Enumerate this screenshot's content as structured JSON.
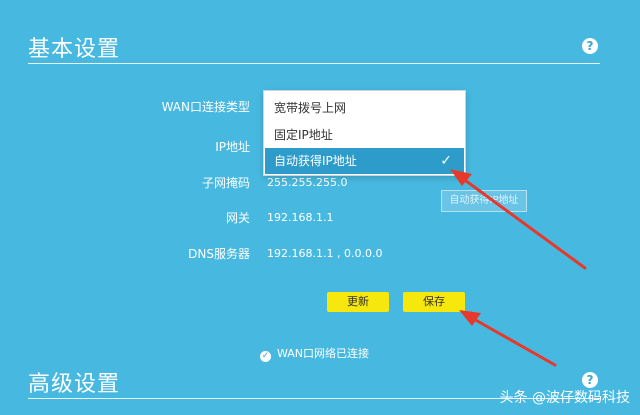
{
  "basic_settings": {
    "title": "基本设置",
    "help_icon": "question-circle-icon",
    "rows": [
      {
        "label": "WAN口连接类型",
        "value": ""
      },
      {
        "label": "IP地址",
        "value": ""
      },
      {
        "label": "子网掩码",
        "value": "255.255.255.0"
      },
      {
        "label": "网关",
        "value": "192.168.1.1"
      },
      {
        "label": "DNS服务器",
        "value": "192.168.1.1 , 0.0.0.0"
      }
    ]
  },
  "connection_type_dropdown": {
    "options": [
      "宽带拨号上网",
      "固定IP地址",
      "自动获得IP地址"
    ],
    "selected": "自动获得IP地址",
    "check_icon": "check-icon"
  },
  "tooltip": {
    "text": "自动获得IP地址"
  },
  "buttons": {
    "refresh": "更新",
    "save": "保存"
  },
  "status": {
    "icon": "check-circle-icon",
    "text": "WAN口网络已连接"
  },
  "advanced_settings": {
    "title": "高级设置",
    "help_icon": "question-circle-icon"
  },
  "watermark": {
    "text": "头条 @波仔数码科技"
  },
  "colors": {
    "background": "#47b9e0",
    "selected": "#2e9ccb",
    "button": "#f6e70d",
    "arrow": "#e6392b"
  }
}
